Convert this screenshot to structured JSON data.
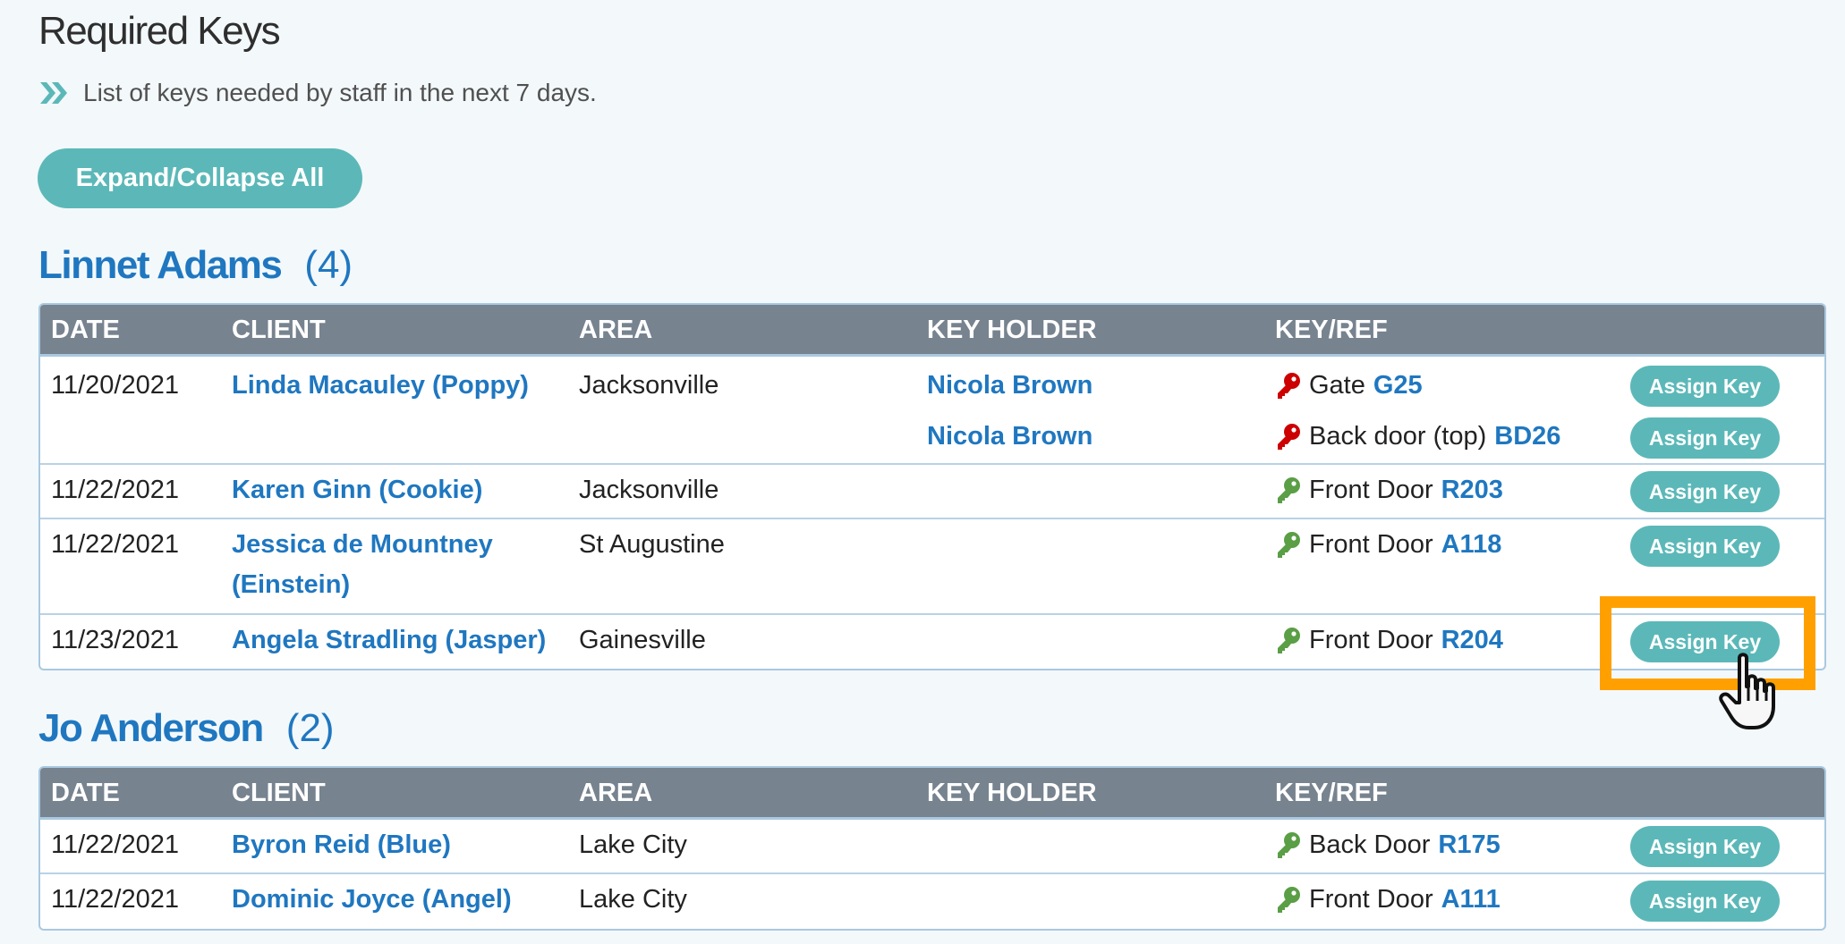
{
  "page": {
    "title": "Required Keys",
    "subtitle": "List of keys needed by staff in the next 7 days.",
    "subtitle_icon": "double-chevron-right-icon",
    "expand_collapse_label": "Expand/Collapse All"
  },
  "colors": {
    "accent_teal": "#5cb8b8",
    "link_blue": "#1f77c0",
    "header_gray": "#77838f",
    "key_red": "#cc0000",
    "key_green": "#5a9e46",
    "highlight_orange": "#ffa000"
  },
  "columns": [
    "DATE",
    "CLIENT",
    "AREA",
    "KEY HOLDER",
    "KEY/REF"
  ],
  "groups": [
    {
      "staff_name": "Linnet Adams",
      "count": "(4)",
      "rows": [
        {
          "date": "11/20/2021",
          "client": "Linda Macauley (Poppy)",
          "area": "Jacksonville",
          "keys": [
            {
              "holder": "Nicola Brown",
              "key_status": "held",
              "key_icon": "red-key-icon",
              "key_name": "Gate",
              "ref": "G25",
              "action": "Assign Key"
            },
            {
              "holder": "Nicola Brown",
              "key_status": "held",
              "key_icon": "red-key-icon",
              "key_name": "Back door (top)",
              "ref": "BD26",
              "action": "Assign Key"
            }
          ]
        },
        {
          "date": "11/22/2021",
          "client": "Karen Ginn (Cookie)",
          "area": "Jacksonville",
          "keys": [
            {
              "holder": "",
              "key_status": "available",
              "key_icon": "green-key-icon",
              "key_name": "Front Door",
              "ref": "R203",
              "action": "Assign Key"
            }
          ]
        },
        {
          "date": "11/22/2021",
          "client": "Jessica de Mountney (Einstein)",
          "area": "St Augustine",
          "keys": [
            {
              "holder": "",
              "key_status": "available",
              "key_icon": "green-key-icon",
              "key_name": "Front Door",
              "ref": "A118",
              "action": "Assign Key"
            }
          ]
        },
        {
          "date": "11/23/2021",
          "client": "Angela Stradling (Jasper)",
          "area": "Gainesville",
          "keys": [
            {
              "holder": "",
              "key_status": "available",
              "key_icon": "green-key-icon",
              "key_name": "Front Door",
              "ref": "R204",
              "action": "Assign Key",
              "highlighted": true
            }
          ]
        }
      ]
    },
    {
      "staff_name": "Jo Anderson",
      "count": "(2)",
      "rows": [
        {
          "date": "11/22/2021",
          "client": "Byron Reid (Blue)",
          "area": "Lake City",
          "keys": [
            {
              "holder": "",
              "key_status": "available",
              "key_icon": "green-key-icon",
              "key_name": "Back Door",
              "ref": "R175",
              "action": "Assign Key"
            }
          ]
        },
        {
          "date": "11/22/2021",
          "client": "Dominic Joyce (Angel)",
          "area": "Lake City",
          "keys": [
            {
              "holder": "",
              "key_status": "available",
              "key_icon": "green-key-icon",
              "key_name": "Front Door",
              "ref": "A111",
              "action": "Assign Key"
            }
          ]
        }
      ]
    }
  ],
  "overlay": {
    "highlight_target": "assign-key-button (Angela Stradling, R204)",
    "cursor": "hand-pointer-icon"
  }
}
